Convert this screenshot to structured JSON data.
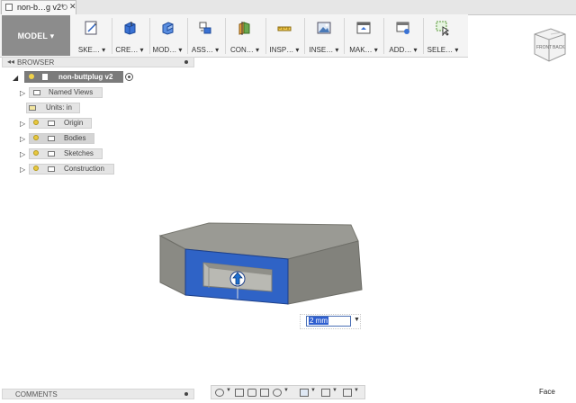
{
  "tabs": [
    {
      "title": "non-b…g v2*"
    }
  ],
  "toolbar": {
    "workspace": "MODEL ▾",
    "groups": [
      {
        "label": "SKE… ▾",
        "icon": "sketch-icon"
      },
      {
        "label": "CRE… ▾",
        "icon": "create-icon"
      },
      {
        "label": "MOD… ▾",
        "icon": "modify-icon"
      },
      {
        "label": "ASS… ▾",
        "icon": "assemble-icon"
      },
      {
        "label": "CON… ▾",
        "icon": "construct-icon"
      },
      {
        "label": "INSP… ▾",
        "icon": "inspect-icon"
      },
      {
        "label": "INSE… ▾",
        "icon": "insert-icon"
      },
      {
        "label": "MAK… ▾",
        "icon": "make-icon"
      },
      {
        "label": "ADD… ▾",
        "icon": "addins-icon"
      },
      {
        "label": "SELE… ▾",
        "icon": "select-icon"
      }
    ]
  },
  "viewcube": {
    "front": "FRONT",
    "back": "BACK"
  },
  "browser": {
    "title": "BROWSER",
    "root": "non-buttplug v2",
    "items": [
      {
        "label": "Named Views"
      },
      {
        "label": "Units: in"
      },
      {
        "label": "Origin"
      },
      {
        "label": "Bodies"
      },
      {
        "label": "Sketches"
      },
      {
        "label": "Construction"
      }
    ]
  },
  "dimension": {
    "value": "2 mm"
  },
  "comments": {
    "title": "COMMENTS"
  },
  "status": {
    "selection": "Face"
  },
  "colors": {
    "accent": "#2f63c6",
    "body": "#9a9a94",
    "panel": "#e4e4e4"
  }
}
